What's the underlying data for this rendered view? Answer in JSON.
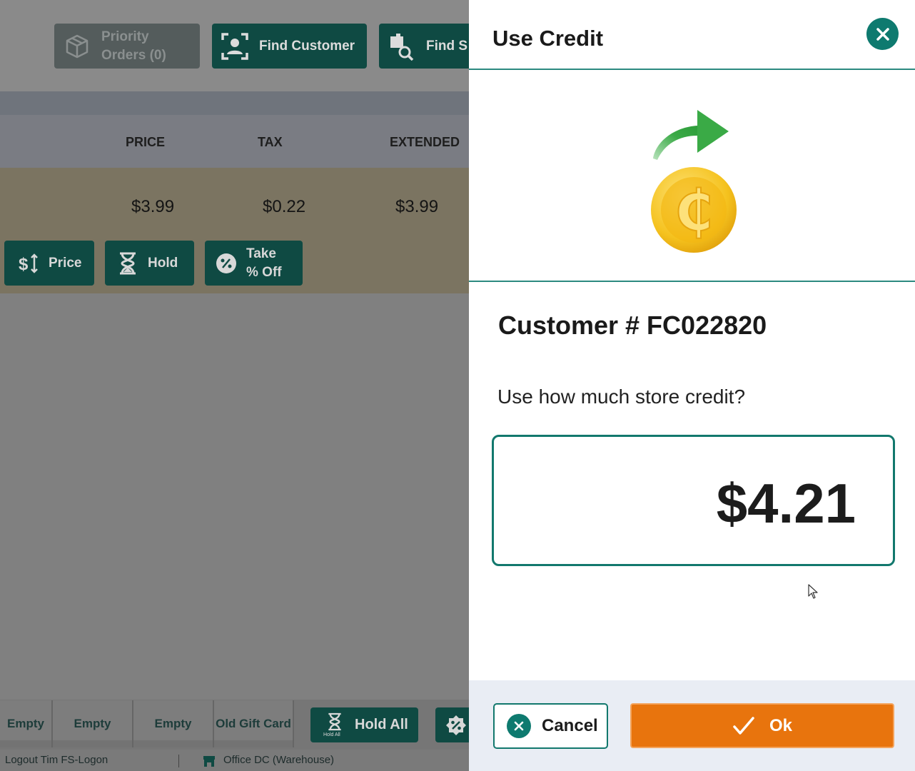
{
  "background": {
    "toolbar": {
      "priority_orders_line1": "Priority",
      "priority_orders_line2": "Orders (0)",
      "find_customer": "Find Customer",
      "find_s": "Find S"
    },
    "columns": [
      "PRICE",
      "TAX",
      "EXTENDED"
    ],
    "item": {
      "price": "$3.99",
      "tax": "$0.22",
      "extended": "$3.99"
    },
    "actions": {
      "price": "Price",
      "hold": "Hold",
      "take_line1": "Take",
      "take_line2": "% Off"
    },
    "tiles": [
      "Empty",
      "Empty",
      "Empty",
      "Old Gift Card"
    ],
    "hold_all": "Hold All",
    "hold_all_icon_caption": "Hold All",
    "status": {
      "logout": "Logout Tim FS-Logon",
      "location": "Office DC (Warehouse)"
    }
  },
  "dialog": {
    "title": "Use Credit",
    "customer": "Customer # FC022820",
    "prompt": "Use how much store credit?",
    "amount": "$4.21",
    "cancel_label": "Cancel",
    "ok_label": "Ok"
  },
  "colors": {
    "teal": "#0e7a6f",
    "orange": "#e8740d",
    "coin_gold": "#f2bd1d",
    "arrow_green": "#3aaa46"
  }
}
